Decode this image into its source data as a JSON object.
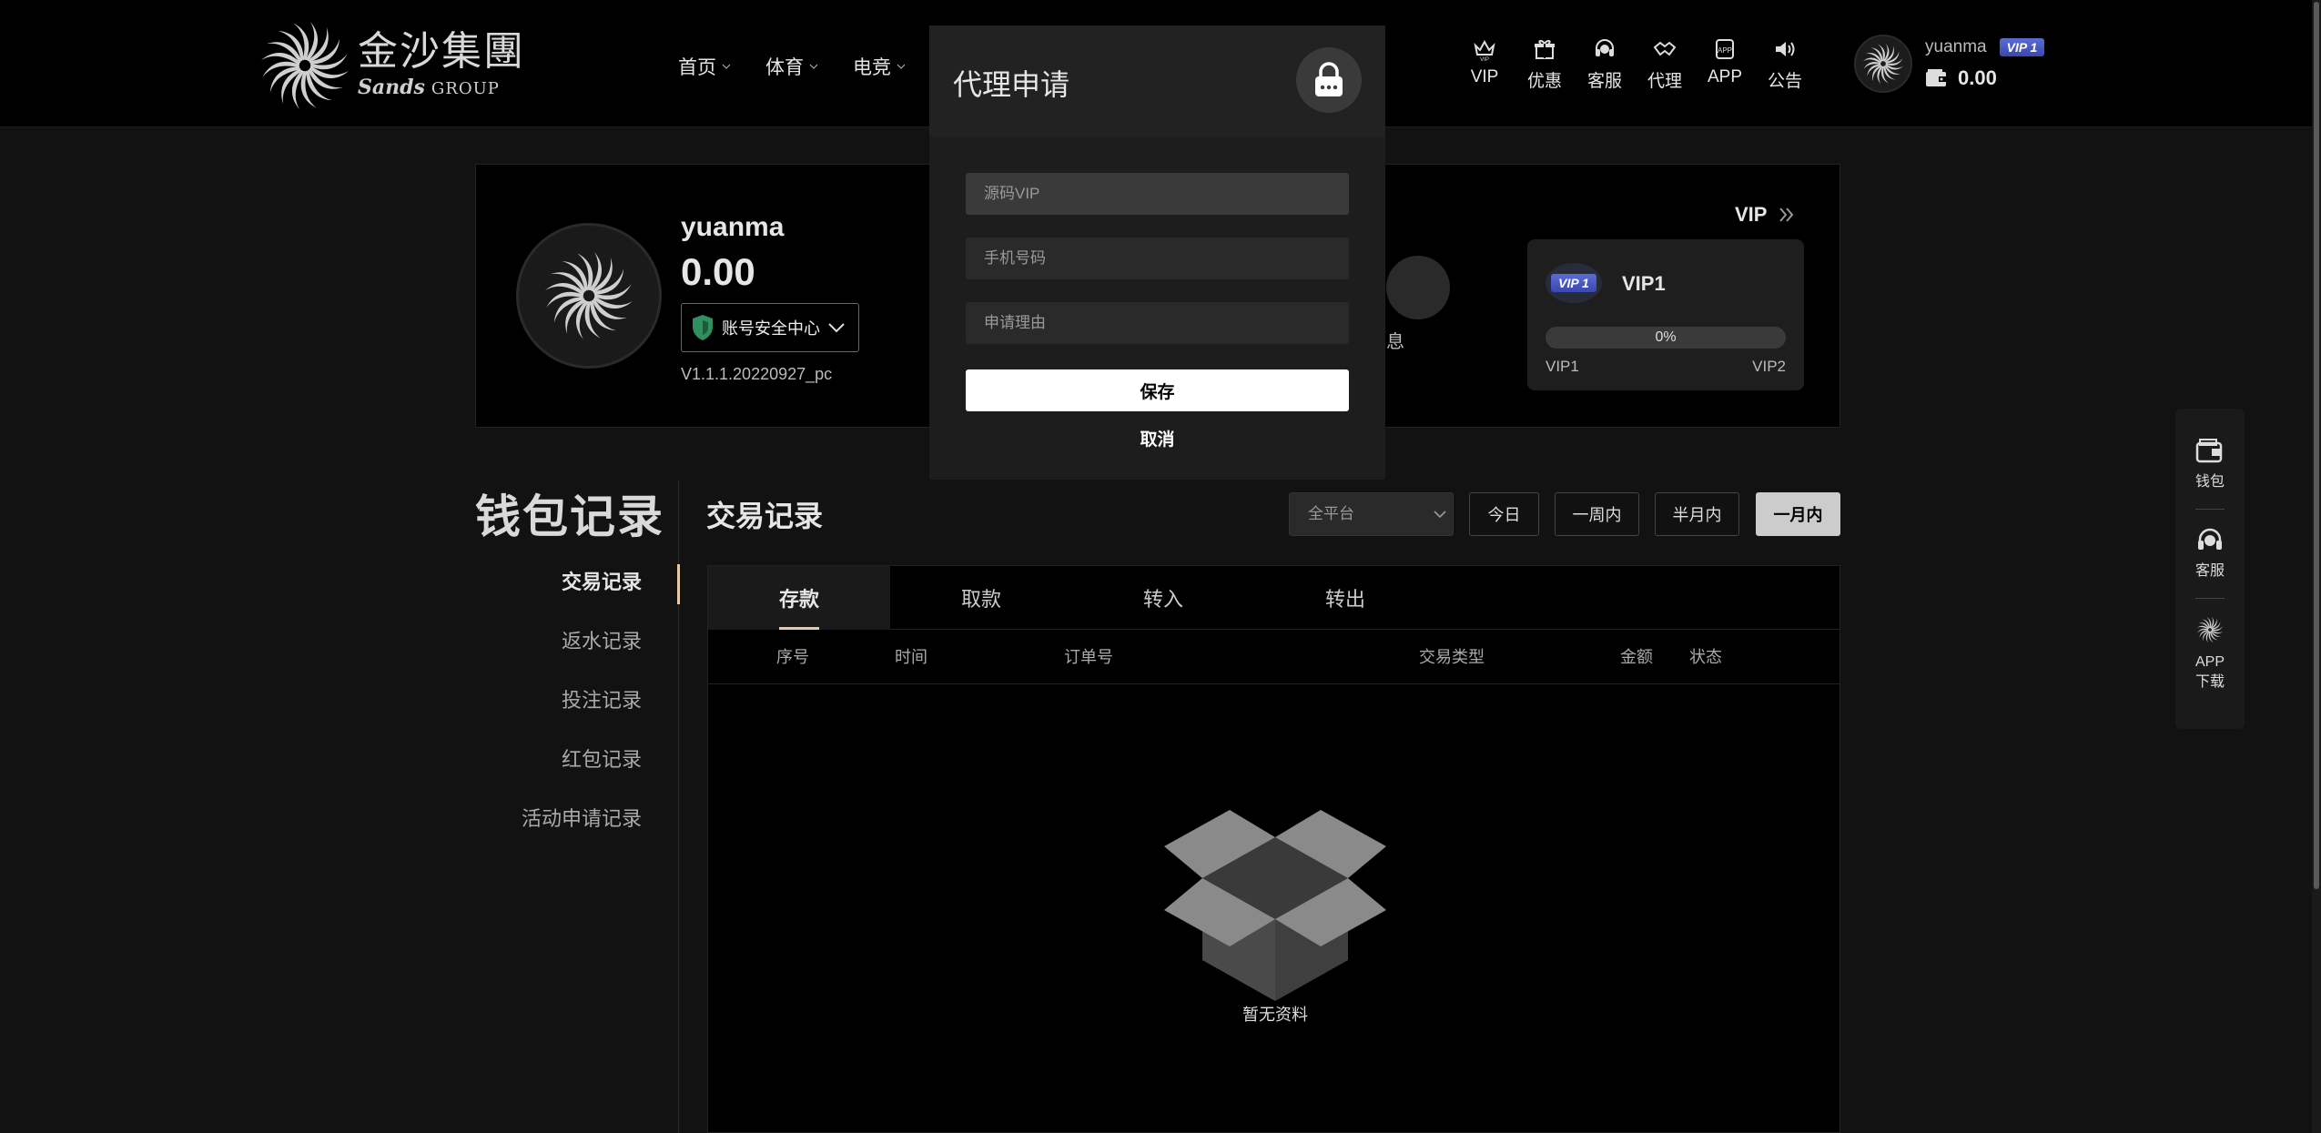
{
  "header": {
    "logo_cn": "金沙集團",
    "logo_en_script": "Sands",
    "logo_en_group": "GROUP",
    "nav": [
      {
        "label": "首页"
      },
      {
        "label": "体育"
      },
      {
        "label": "电竞"
      }
    ],
    "icons": [
      {
        "label": "VIP",
        "icon": "crown-icon"
      },
      {
        "label": "优惠",
        "icon": "gift-icon"
      },
      {
        "label": "客服",
        "icon": "headset-icon"
      },
      {
        "label": "代理",
        "icon": "handshake-icon"
      },
      {
        "label": "APP",
        "icon": "app-icon"
      },
      {
        "label": "公告",
        "icon": "speaker-icon"
      }
    ],
    "user": {
      "name": "yuanma",
      "vip_badge": "VIP 1",
      "balance": "0.00"
    }
  },
  "profile": {
    "name": "yuanma",
    "balance": "0.00",
    "security_label": "账号安全中心",
    "version": "V1.1.1.20220927_pc",
    "message_label_partial": "息",
    "vip_heading": "VIP",
    "vip_card": {
      "badge": "VIP 1",
      "level": "VIP1",
      "progress_text": "0%",
      "progress": 0,
      "from": "VIP1",
      "to": "VIP2"
    }
  },
  "sidebar": {
    "title": "钱包记录",
    "items": [
      {
        "label": "交易记录"
      },
      {
        "label": "返水记录"
      },
      {
        "label": "投注记录"
      },
      {
        "label": "红包记录"
      },
      {
        "label": "活动申请记录"
      }
    ]
  },
  "content": {
    "title": "交易记录",
    "platform_select": "全平台",
    "ranges": [
      {
        "label": "今日"
      },
      {
        "label": "一周内"
      },
      {
        "label": "半月内"
      },
      {
        "label": "一月内"
      }
    ],
    "tabs": [
      {
        "label": "存款"
      },
      {
        "label": "取款"
      },
      {
        "label": "转入"
      },
      {
        "label": "转出"
      }
    ],
    "columns": [
      "序号",
      "时间",
      "订单号",
      "交易类型",
      "金额",
      "状态"
    ],
    "empty_text": "暂无资料"
  },
  "floatbar": {
    "items": [
      {
        "label": "钱包"
      },
      {
        "label": "客服"
      },
      {
        "label": "APP"
      },
      {
        "label": "下载"
      }
    ]
  },
  "modal": {
    "title": "代理申请",
    "fields": [
      {
        "placeholder": "源码VIP"
      },
      {
        "placeholder": "手机号码"
      },
      {
        "placeholder": "申请理由"
      }
    ],
    "save_label": "保存",
    "cancel_label": "取消"
  },
  "colors": {
    "accent": "#e6c9a8",
    "vip_blue": "#4a5ac6",
    "background": "#121212"
  }
}
